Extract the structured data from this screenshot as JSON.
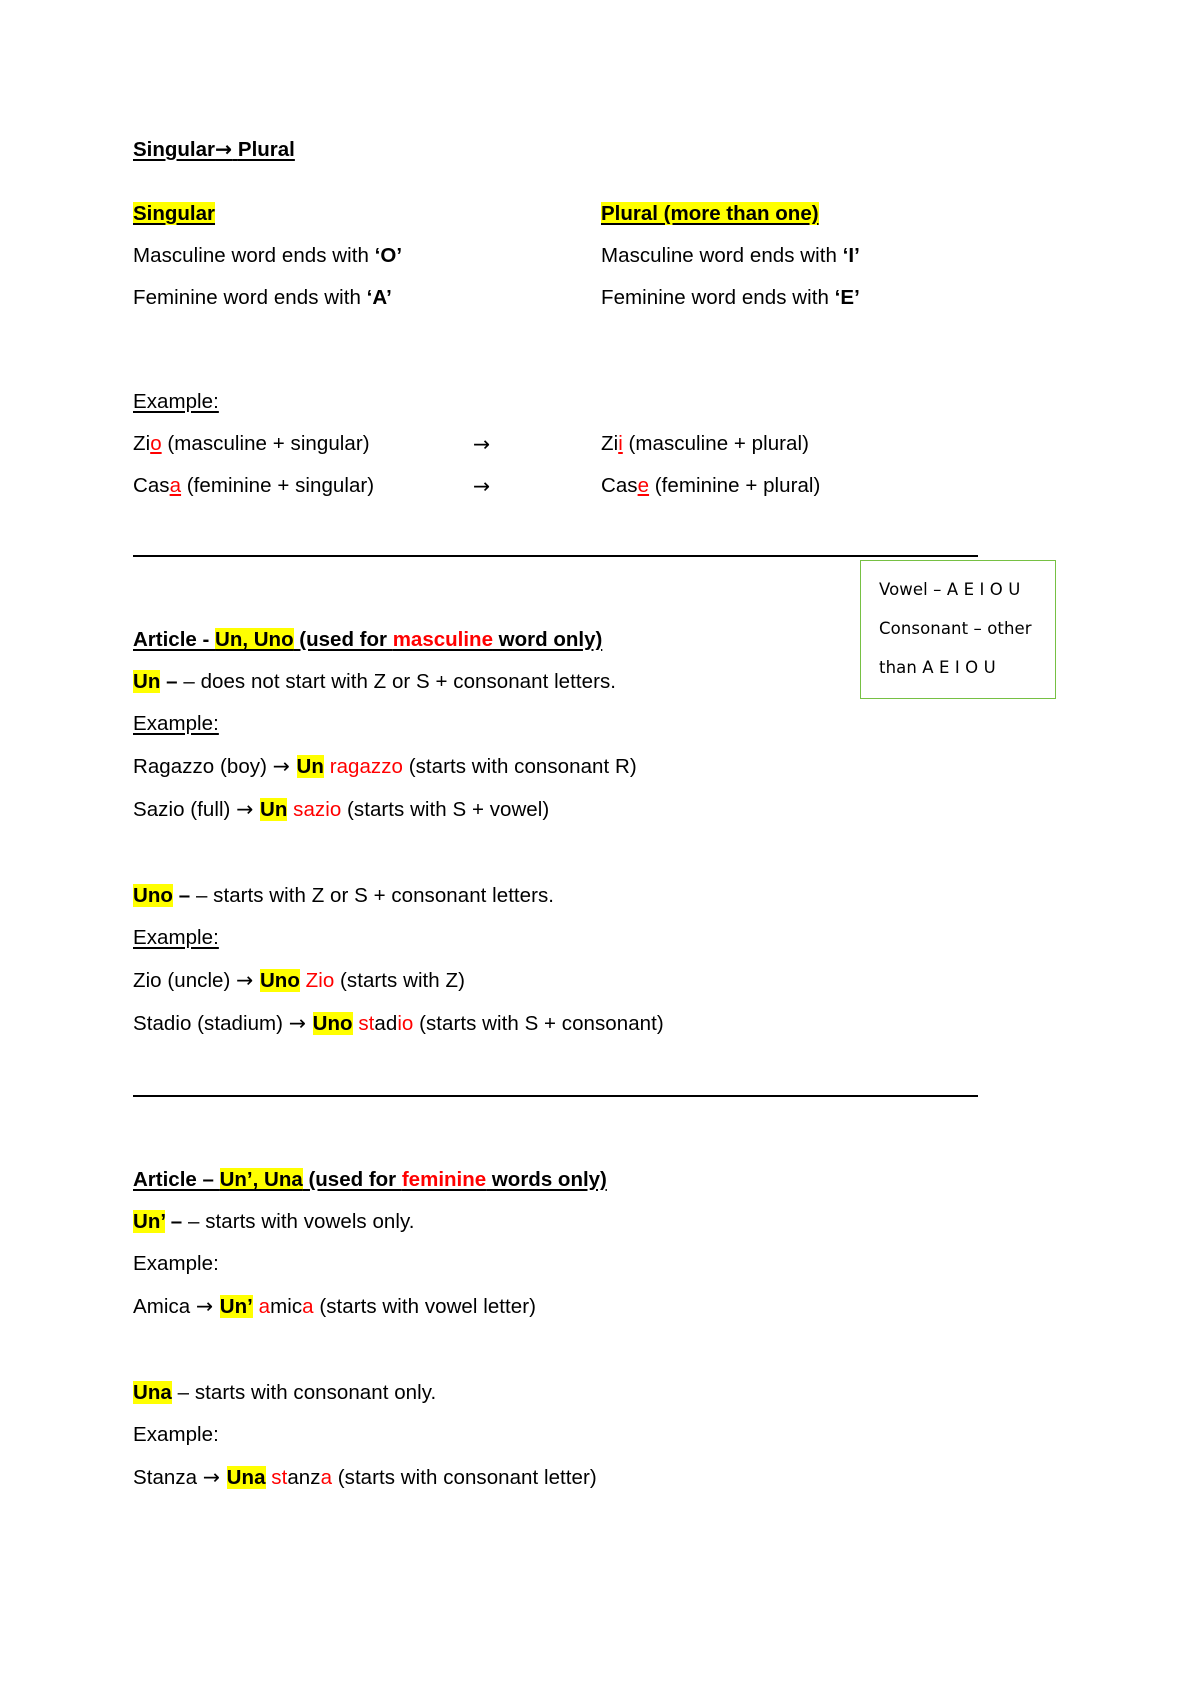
{
  "document": {
    "colors": {
      "highlight": "#FFFF00",
      "accent_red": "#FF0000",
      "note_border": "#76C043",
      "rule": "#000000"
    },
    "arrow_glyph": "→"
  },
  "section_plural": {
    "heading_singular": "Singular",
    "heading_arrow": "→",
    "heading_plural": "Plural",
    "col_header_left": "Singular",
    "col_header_right": "Plural (more than one)",
    "rules": [
      {
        "left_text": "Masculine word ends with ",
        "left_letter": "‘O’",
        "right_text": "Masculine word ends with ",
        "right_letter": "‘I’"
      },
      {
        "left_text": "Feminine word ends with ",
        "left_letter": "‘A’",
        "right_text": "Feminine word ends with ",
        "right_letter": "‘E’"
      }
    ],
    "example_label": "Example:",
    "examples": [
      {
        "left_stem": "Zi",
        "left_ending": "o",
        "left_note": " (masculine + singular)",
        "arrow": "→",
        "right_stem": "Zi",
        "right_ending": "i",
        "right_note": " (masculine + plural)"
      },
      {
        "left_stem": "Cas",
        "left_ending": "a",
        "left_note": " (feminine + singular)",
        "arrow": "→",
        "right_stem": "Cas",
        "right_ending": "e",
        "right_note": " (feminine + plural)"
      }
    ]
  },
  "section_masculine": {
    "heading_prefix": "Article - ",
    "heading_articles": "Un, Uno",
    "heading_mid": " (used for ",
    "heading_gender": "masculine",
    "heading_suffix": " word only)",
    "un_rule_article": "Un",
    "un_rule_text": " – does not start with Z or S + consonant letters.",
    "un_example_label": "Example:",
    "un_examples": [
      {
        "word": "Ragazzo (boy) ",
        "arrow": "→ ",
        "article": "Un",
        "result_red_1": " ragazz",
        "result_black": "",
        "result_red_2": "o",
        "note": " (starts with consonant R)"
      },
      {
        "word": "Sazio (full) ",
        "arrow": "→ ",
        "article": "Un",
        "result_red_1": " sazi",
        "result_black": "",
        "result_red_2": "o",
        "note": " (starts with S + vowel)"
      }
    ],
    "uno_rule_article": "Uno",
    "uno_rule_text": " – starts with Z or S + consonant letters.",
    "uno_example_label": "Example:",
    "uno_examples": [
      {
        "word": "Zio (uncle) ",
        "arrow": "→ ",
        "article": "Uno",
        "result_red_1": " Zio",
        "result_black": "",
        "result_red_2": "",
        "note": " (starts with Z)"
      },
      {
        "word": "Stadio (stadium) ",
        "arrow": "→ ",
        "article": "Uno",
        "result_red_1": " st",
        "result_black": "ad",
        "result_red_2": "io",
        "note": " (starts with S + consonant)"
      }
    ]
  },
  "section_feminine": {
    "heading_prefix": "Article – ",
    "heading_articles": "Un’, Una",
    "heading_mid": " (used for ",
    "heading_gender": "feminine",
    "heading_suffix": " words only)",
    "un_rule_article": "Un’",
    "un_rule_text": " – starts with vowels only.",
    "un_example_label": "Example:",
    "un_examples": [
      {
        "word": "Amica ",
        "arrow": "→ ",
        "article": "Un’",
        "result_red_1": " a",
        "result_black": "mic",
        "result_red_2": "a",
        "note": " (starts with vowel letter)"
      }
    ],
    "una_rule_article": "Una",
    "una_rule_text": " – starts with consonant only.",
    "una_example_label": "Example:",
    "una_examples": [
      {
        "word": "Stanza ",
        "arrow": "→ ",
        "article": "Una",
        "result_red_1": " st",
        "result_black": "anz",
        "result_red_2": "a",
        "note": " (starts with consonant letter)"
      }
    ]
  },
  "note_box": {
    "line_vowel": "Vowel – A E I O U",
    "line_consonant_1": "Consonant – other",
    "line_consonant_2": "than A E I O U"
  }
}
